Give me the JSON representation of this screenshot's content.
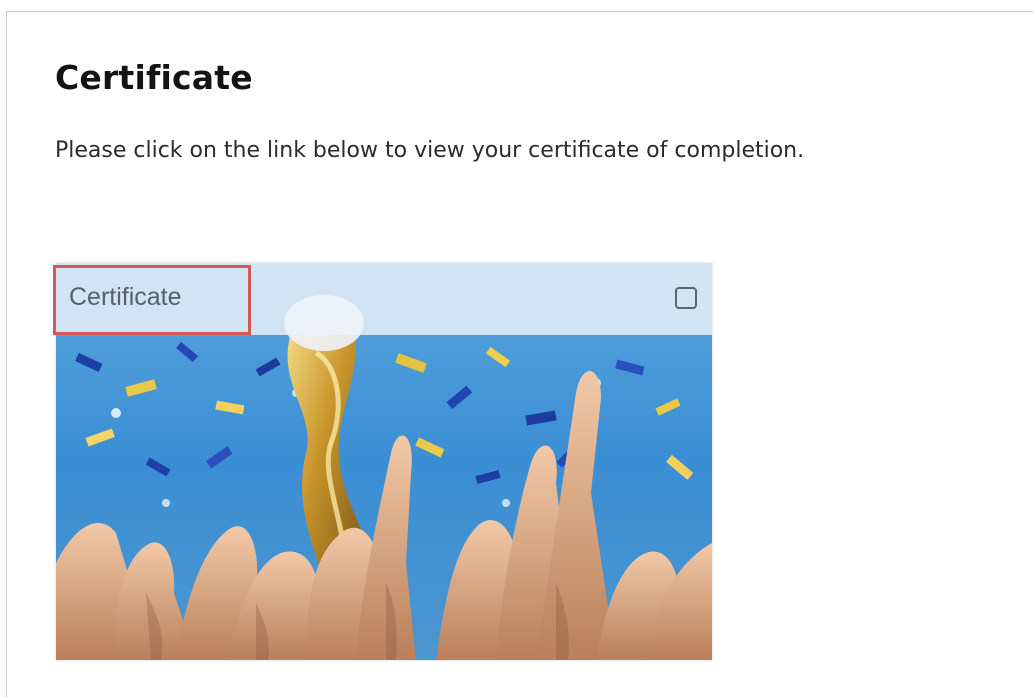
{
  "page": {
    "title": "Certificate",
    "instructions": "Please click on the link below to view your certificate of completion."
  },
  "certificate_card": {
    "label": "Certificate",
    "image_subject": "trophy-celebration-confetti-image",
    "checkbox_icon": "square-checkbox-icon",
    "checkbox_checked": false
  },
  "colors": {
    "highlight_border": "#d65757",
    "card_header_bg": "#eef3f9",
    "label_text": "#55606e"
  }
}
